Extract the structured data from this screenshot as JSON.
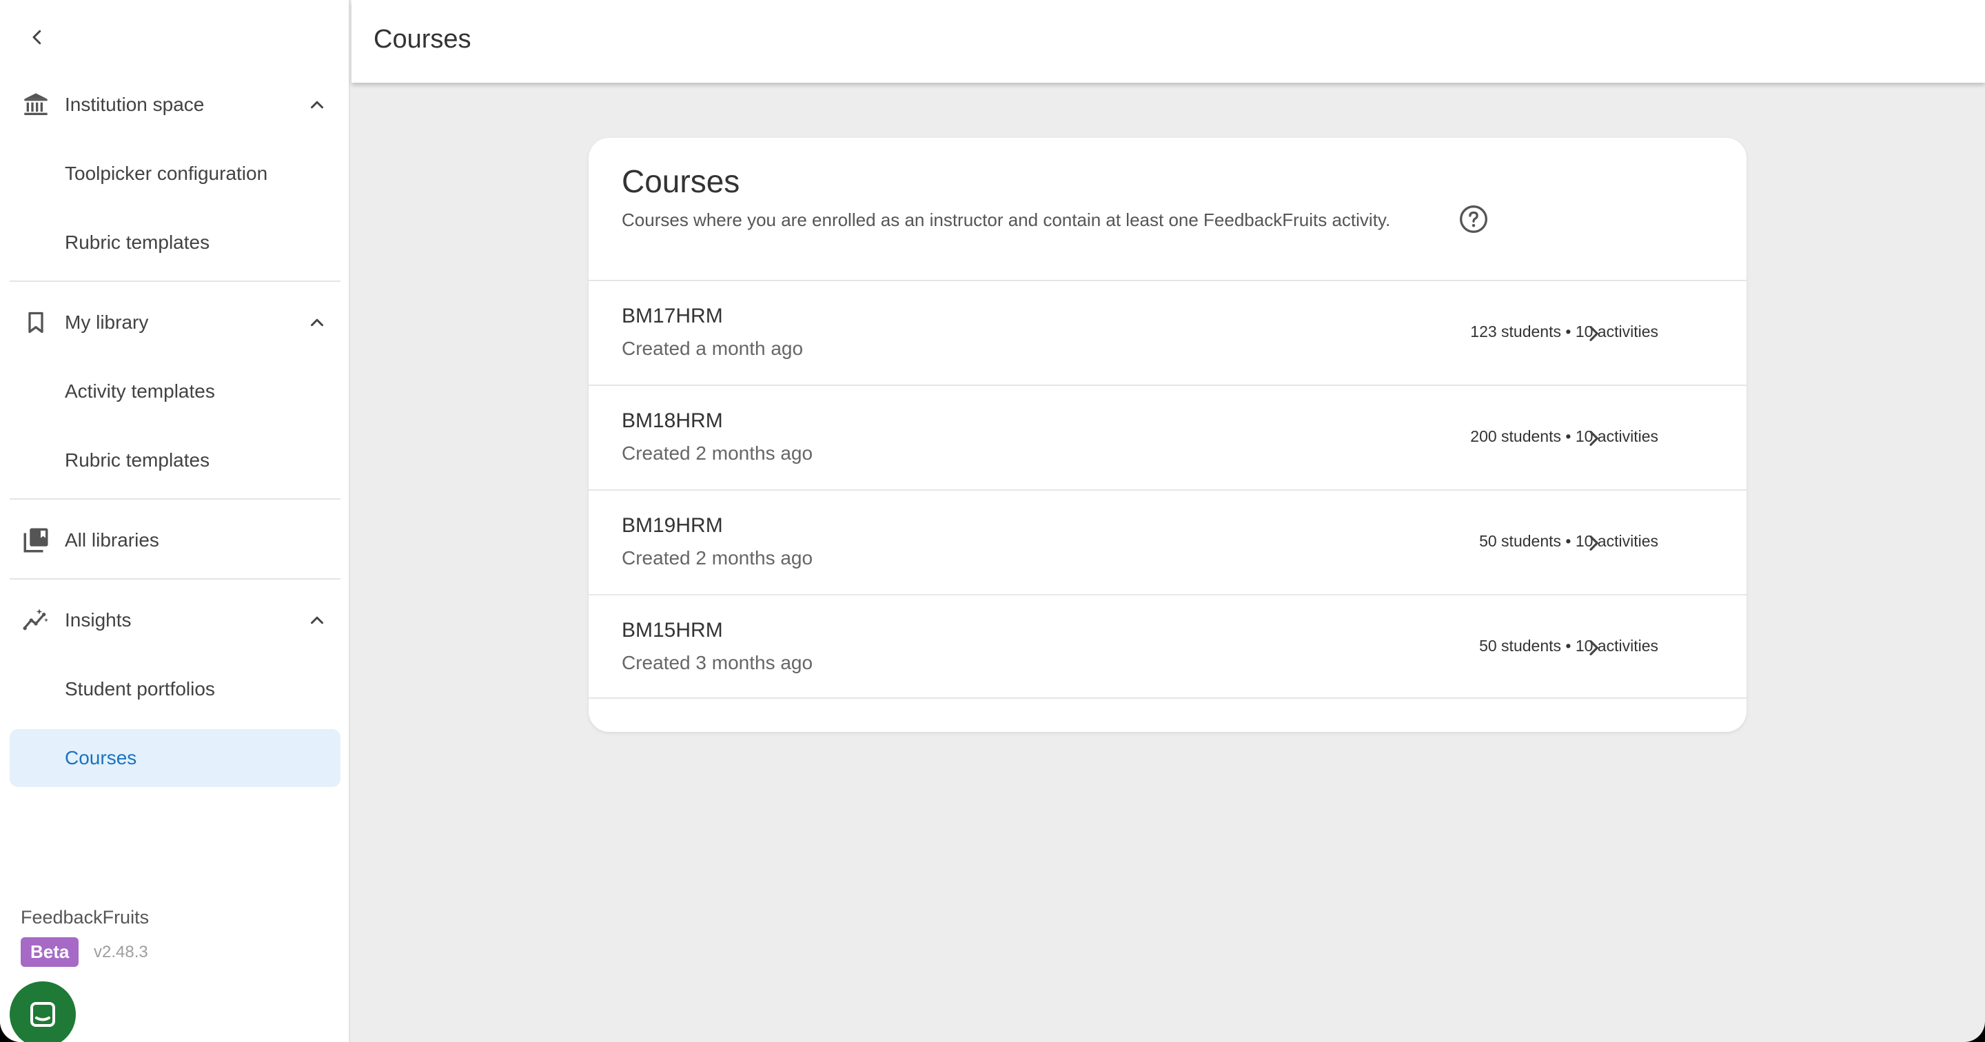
{
  "sidebar": {
    "back_icon": "chevron-left-icon",
    "sections": {
      "institution": {
        "label": "Institution space",
        "icon": "institution-icon",
        "items": [
          "Toolpicker configuration",
          "Rubric templates"
        ]
      },
      "library": {
        "label": "My library",
        "icon": "bookmark-icon",
        "items": [
          "Activity templates",
          "Rubric templates"
        ]
      },
      "all_libraries": {
        "label": "All libraries",
        "icon": "library-books-icon"
      },
      "insights": {
        "label": "Insights",
        "icon": "insights-icon",
        "items": [
          "Student portfolios",
          "Courses"
        ]
      }
    },
    "brand": "FeedbackFruits",
    "beta_label": "Beta",
    "version": "v2.48.3"
  },
  "topbar": {
    "title": "Courses"
  },
  "card": {
    "title": "Courses",
    "subtitle": "Courses where you are enrolled as an instructor and contain at least one FeedbackFruits activity.",
    "courses": [
      {
        "name": "BM17HRM",
        "created": "Created a month ago",
        "meta": "123 students • 10 activities"
      },
      {
        "name": "BM18HRM",
        "created": "Created 2 months ago",
        "meta": "200 students • 10 activities"
      },
      {
        "name": "BM19HRM",
        "created": "Created 2 months ago",
        "meta": "50 students • 10 activities"
      },
      {
        "name": "BM15HRM",
        "created": "Created 3 months ago",
        "meta": "50 students • 10 activities"
      }
    ]
  },
  "colors": {
    "accent": "#1a73c0",
    "active_bg": "#e4f0fb",
    "beta": "#a66ac6",
    "chat": "#1e7a36",
    "background": "#ededed"
  }
}
